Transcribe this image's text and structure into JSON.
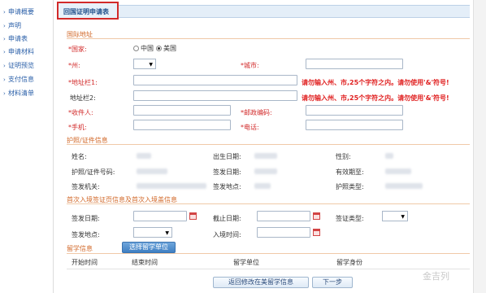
{
  "sidebar": {
    "items": [
      {
        "label": "申请概要"
      },
      {
        "label": "声明"
      },
      {
        "label": "申请表"
      },
      {
        "label": "申请材料"
      },
      {
        "label": "证明预览"
      },
      {
        "label": "支付信息"
      },
      {
        "label": "材料清单"
      }
    ]
  },
  "header": {
    "title": "回国证明申请表"
  },
  "address": {
    "section_title": "国际地址",
    "country_label": "*国家:",
    "country_options": [
      "中国",
      "美国"
    ],
    "country_selected": "美国",
    "state_label": "*州:",
    "city_label": "*城市:",
    "addr1_label": "*地址栏1:",
    "addr1_warning": "请勿输入州、市,25个字符之内。请勿使用'&'符号!",
    "addr2_label": "地址栏2:",
    "addr2_warning": "请勿输入州、市,25个字符之内。请勿使用'&'符号!",
    "recipient_label": "*收件人:",
    "postcode_label": "*邮政编码:",
    "mobile_label": "*手机:",
    "phone_label": "*电话:"
  },
  "passport": {
    "section_title": "护照/证件信息",
    "name_label": "姓名:",
    "birth_label": "出生日期:",
    "gender_label": "性别:",
    "number_label": "护照/证件号码:",
    "issue_date_label": "签发日期:",
    "expiry_label": "有效期至:",
    "authority_label": "签发机关:",
    "issue_place_label": "签发地点:",
    "type_label": "护照类型:"
  },
  "entry": {
    "section_title": "首次入境签证页信息及首次入境盖信息",
    "visa_issue_label": "签发日期:",
    "expiry_label": "截止日期:",
    "visa_type_label": "签证类型:",
    "issue_place_label": "签发地点:",
    "entry_time_label": "入境时间:"
  },
  "study": {
    "section_title": "留学信息",
    "select_button": "选择留学单位",
    "columns": [
      "开始时间",
      "结束时间",
      "留学单位",
      "留学身份"
    ]
  },
  "footer": {
    "back_button": "返回修改在美留学信息",
    "next_button": "下一步"
  },
  "watermark": "金吉列"
}
